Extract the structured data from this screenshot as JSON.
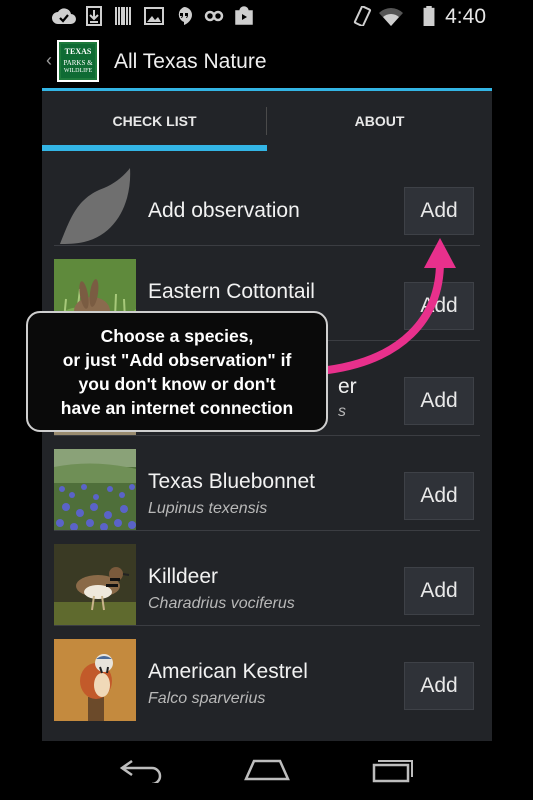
{
  "status_bar": {
    "time": "4:40",
    "icons_left": [
      "check-circle-icon",
      "download-icon",
      "barcode-icon",
      "image-icon",
      "hangouts-icon",
      "link-icon",
      "play-store-icon"
    ],
    "icons_right": [
      "vibrate-icon",
      "wifi-icon",
      "battery-icon"
    ]
  },
  "action_bar": {
    "title": "All Texas Nature",
    "logo_lines": [
      "TEXAS",
      "PARKS &",
      "WILDLIFE"
    ]
  },
  "tabs": [
    {
      "label": "CHECK LIST",
      "selected": true
    },
    {
      "label": "ABOUT",
      "selected": false
    }
  ],
  "list": {
    "add_label": "Add",
    "generic": {
      "name": "Add observation"
    },
    "items": [
      {
        "name": "Eastern Cottontail",
        "scientific": ""
      },
      {
        "name": "er",
        "scientific": "s"
      },
      {
        "name": "Texas Bluebonnet",
        "scientific": "Lupinus texensis"
      },
      {
        "name": "Killdeer",
        "scientific": "Charadrius vociferus"
      },
      {
        "name": "American Kestrel",
        "scientific": "Falco sparverius"
      }
    ]
  },
  "callout": {
    "lines": [
      "Choose a species,",
      "or just \"Add observation\" if",
      "you don't know or don't",
      "have an internet connection"
    ],
    "arrow_color": "#e8308c"
  },
  "colors": {
    "accent": "#33b5e5",
    "list_bg": "#222428"
  }
}
